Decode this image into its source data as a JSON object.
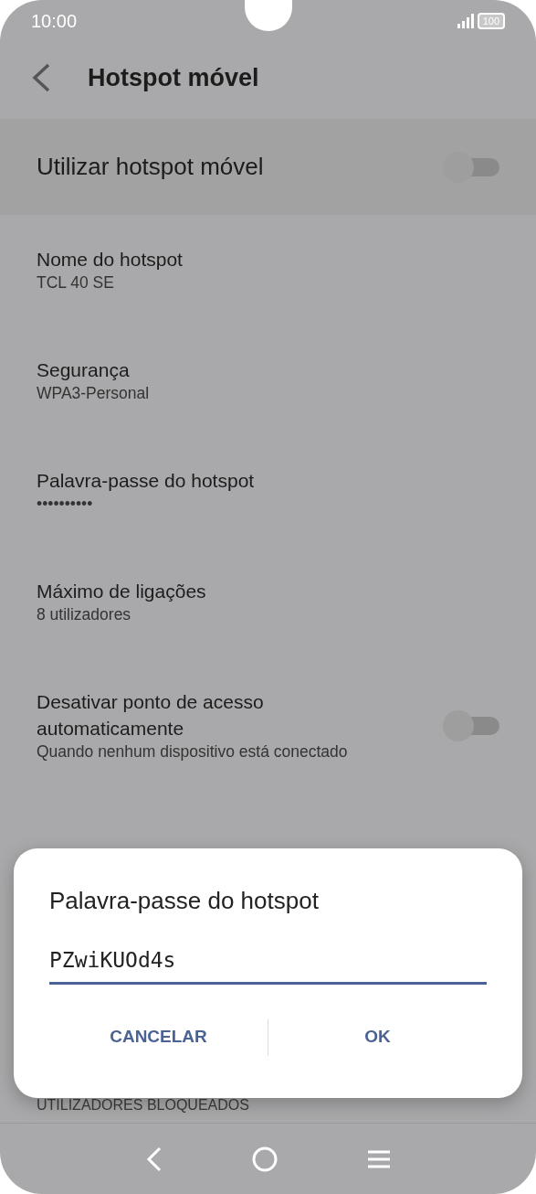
{
  "status_bar": {
    "time": "10:00",
    "battery": "100"
  },
  "header": {
    "title": "Hotspot móvel"
  },
  "settings": [
    {
      "kind": "master",
      "title": "Utilizar hotspot móvel",
      "on": false
    },
    {
      "kind": "text",
      "title": "Nome do hotspot",
      "summary": "TCL 40 SE"
    },
    {
      "kind": "text",
      "title": "Segurança",
      "summary": "WPA3-Personal"
    },
    {
      "kind": "text",
      "title": "Palavra-passe do hotspot",
      "summary": "••••••••••"
    },
    {
      "kind": "text",
      "title": "Máximo de ligações",
      "summary": "8 utilizadores"
    },
    {
      "kind": "switch",
      "title": "Desativar ponto de acesso automaticamente",
      "summary": "Quando nenhum dispositivo está conectado",
      "on": false
    }
  ],
  "section_header": "UTILIZADORES BLOQUEADOS",
  "dialog": {
    "title": "Palavra-passe do hotspot",
    "value": "PZwiKUOd4s",
    "buttons": [
      "CANCELAR",
      "OK"
    ]
  }
}
